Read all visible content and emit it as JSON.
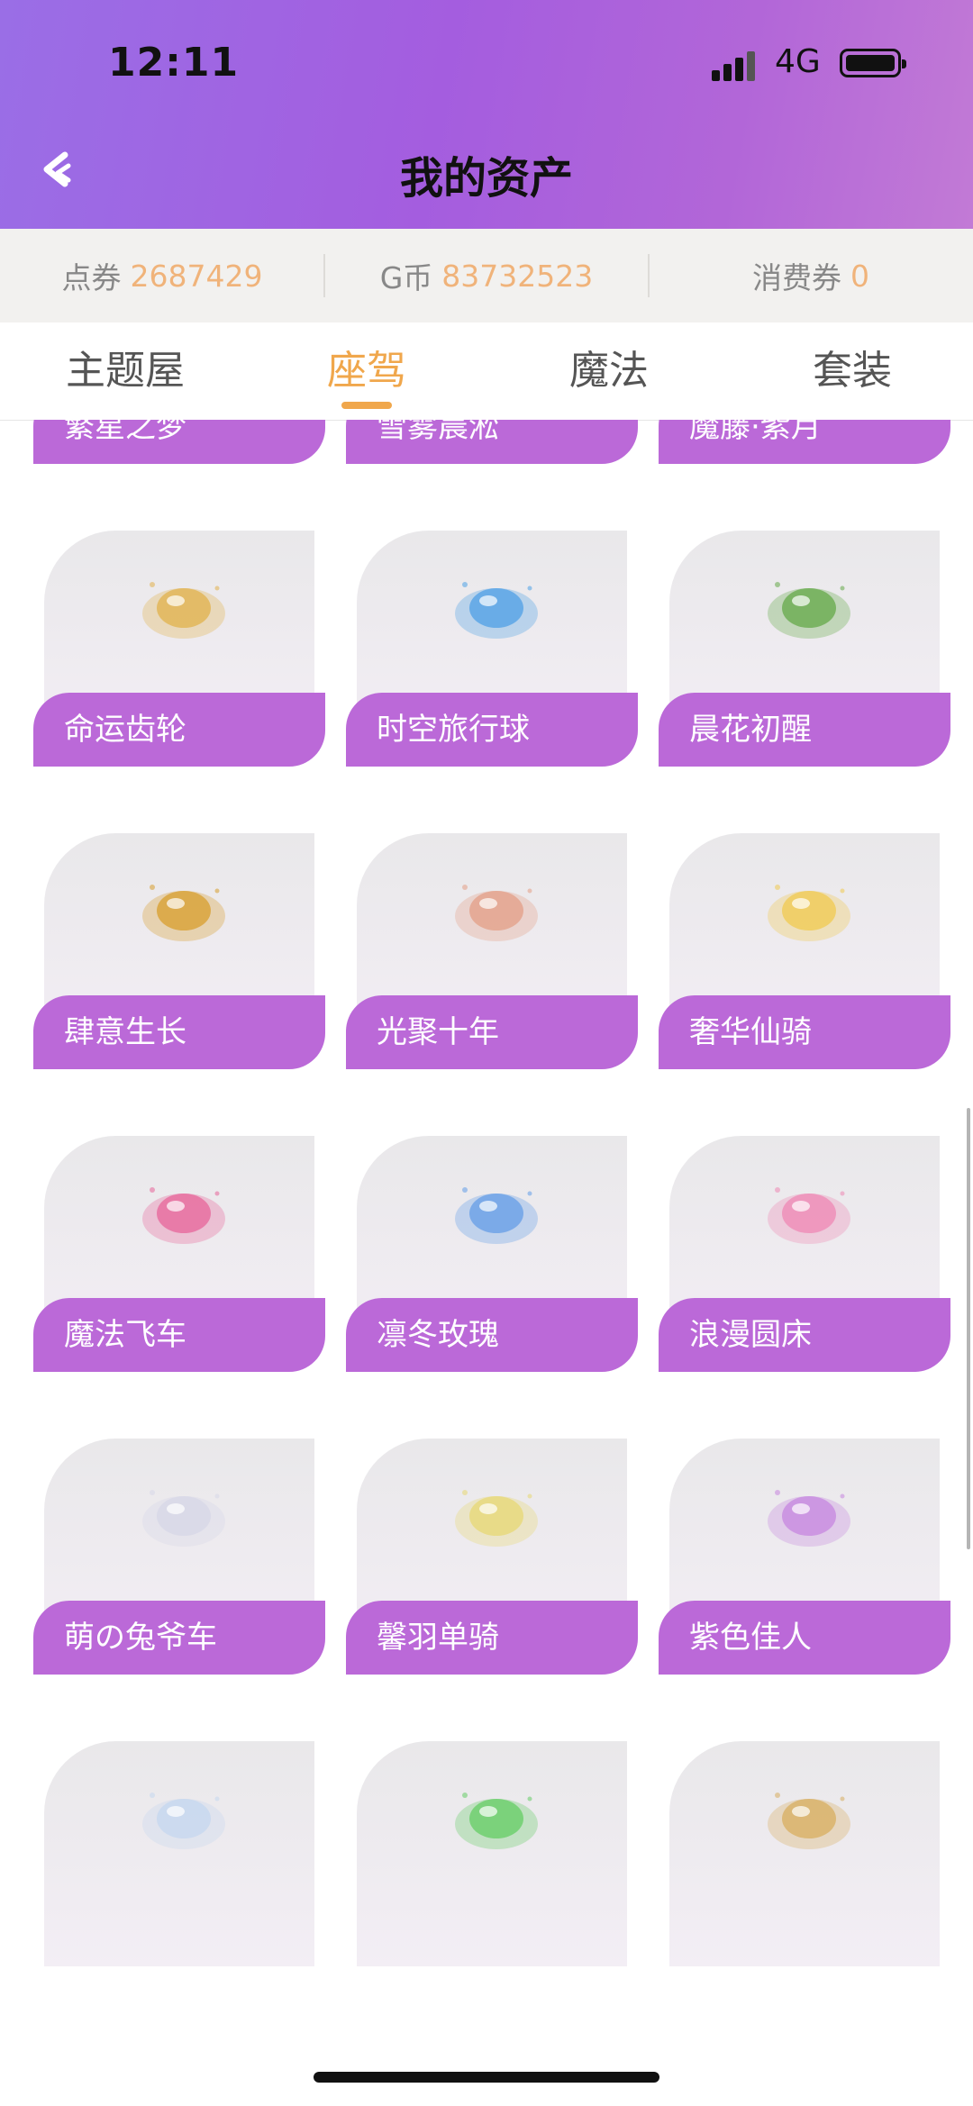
{
  "status": {
    "time": "12:11",
    "network": "4G"
  },
  "header": {
    "title": "我的资产"
  },
  "assets": [
    {
      "label": "点券",
      "value": "2687429"
    },
    {
      "label": "G币",
      "value": "83732523"
    },
    {
      "label": "消费券",
      "value": "0"
    }
  ],
  "tabs": [
    {
      "label": "主题屋"
    },
    {
      "label": "座驾"
    },
    {
      "label": "魔法"
    },
    {
      "label": "套装"
    }
  ],
  "active_tab": "座驾",
  "items": [
    {
      "name": "繁星之梦",
      "icon": "blue-orb-icon",
      "color": "#6f8fe8"
    },
    {
      "name": "雪雾晨淞",
      "icon": "snow-cloud-icon",
      "color": "#9cc8ee"
    },
    {
      "name": "魔藤·紫月",
      "icon": "purple-vine-icon",
      "color": "#c39ae6"
    },
    {
      "name": "命运齿轮",
      "icon": "golden-gear-icon",
      "color": "#e2b658"
    },
    {
      "name": "时空旅行球",
      "icon": "blue-capsule-icon",
      "color": "#5aa6e6"
    },
    {
      "name": "晨花初醒",
      "icon": "green-garden-icon",
      "color": "#6fae55"
    },
    {
      "name": "肆意生长",
      "icon": "golden-leaf-icon",
      "color": "#d9a43c"
    },
    {
      "name": "光聚十年",
      "icon": "sparkle-boat-icon",
      "color": "#e4a58e"
    },
    {
      "name": "奢华仙骑",
      "icon": "golden-carriage-icon",
      "color": "#f0cc5c"
    },
    {
      "name": "魔法飞车",
      "icon": "pink-flying-car-icon",
      "color": "#e76fa0"
    },
    {
      "name": "凛冬玫瑰",
      "icon": "ice-rose-globe-icon",
      "color": "#6ea3e8"
    },
    {
      "name": "浪漫圆床",
      "icon": "pink-round-bed-icon",
      "color": "#ee8fb8"
    },
    {
      "name": "萌の兔爷车",
      "icon": "bunny-car-icon",
      "color": "#d8d8e8"
    },
    {
      "name": "馨羽单骑",
      "icon": "feather-bicycle-icon",
      "color": "#e8d97c"
    },
    {
      "name": "紫色佳人",
      "icon": "purple-lady-icon",
      "color": "#c98ee0"
    },
    {
      "name": "",
      "icon": "crystal-bathtub-icon",
      "color": "#c8d8ee"
    },
    {
      "name": "",
      "icon": "frog-aquarium-icon",
      "color": "#6fcf6f"
    },
    {
      "name": "",
      "icon": "star-carriage-icon",
      "color": "#d9b36a"
    }
  ]
}
